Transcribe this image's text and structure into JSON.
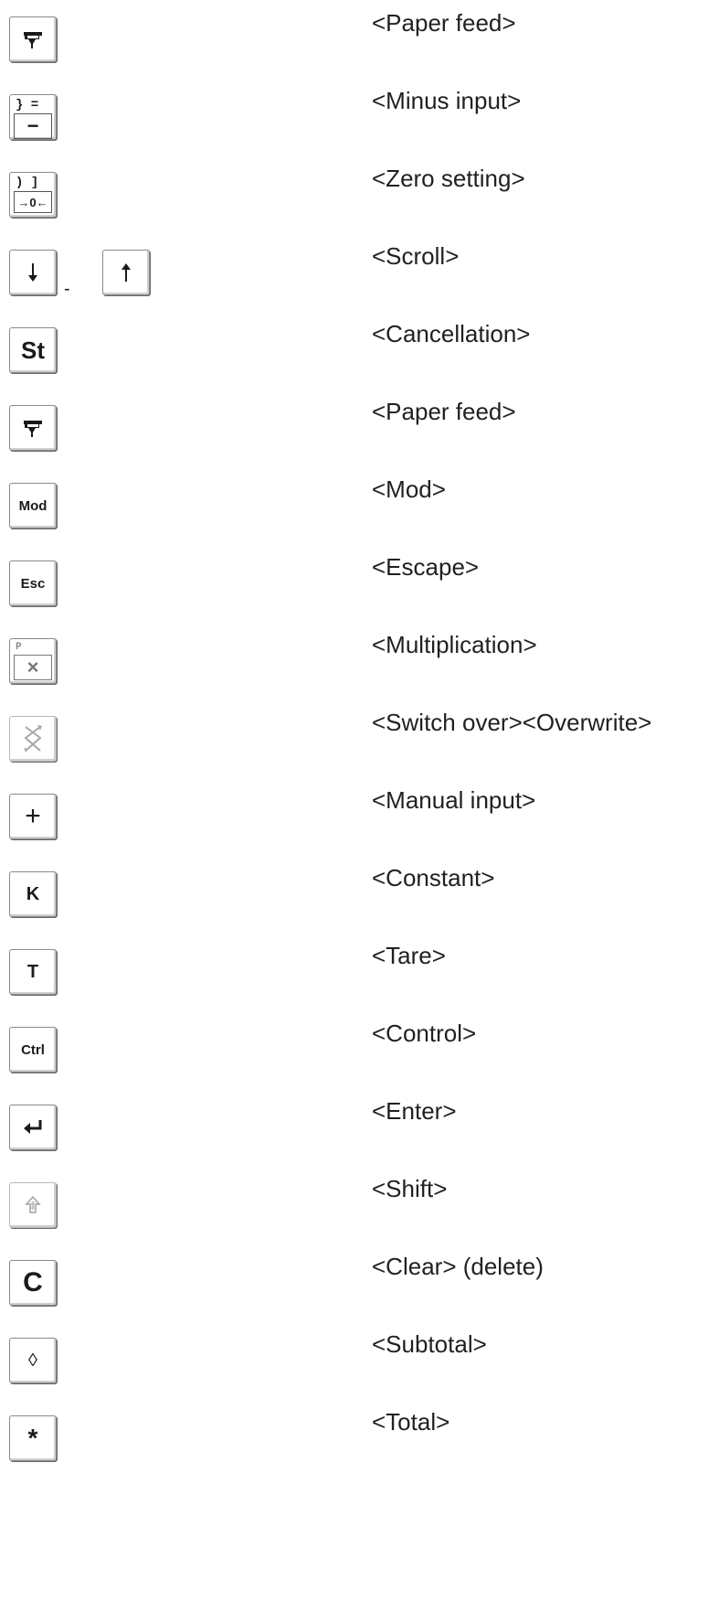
{
  "rows": [
    {
      "label": "<Paper feed>",
      "icon": "paper-feed-icon"
    },
    {
      "label": "<Minus input>",
      "icon": "minus-key-icon",
      "top": "} =",
      "bottom": "−"
    },
    {
      "label": "<Zero setting>",
      "icon": "zero-key-icon",
      "top": ") ]",
      "bottom": "→0←"
    },
    {
      "label": "<Scroll>",
      "icon": "scroll-arrows-icon",
      "sep": "-"
    },
    {
      "label": "<Cancellation>",
      "icon": "st-key-icon",
      "key": "St"
    },
    {
      "label": "<Paper feed>",
      "icon": "paper-feed-icon"
    },
    {
      "label": "<Mod>",
      "icon": "mod-key-icon",
      "key": "Mod"
    },
    {
      "label": "<Escape>",
      "icon": "esc-key-icon",
      "key": "Esc"
    },
    {
      "label": "<Multiplication>",
      "icon": "multiplication-key-icon",
      "top": "P",
      "bottom": "×"
    },
    {
      "label": "<Switch over><Overwrite>",
      "icon": "switch-over-icon"
    },
    {
      "label": "<Manual input>",
      "icon": "plus-key-icon",
      "key": "+"
    },
    {
      "label": "<Constant>",
      "icon": "k-key-icon",
      "key": "K"
    },
    {
      "label": "<Tare>",
      "icon": "t-key-icon",
      "key": "T"
    },
    {
      "label": "<Control>",
      "icon": "ctrl-key-icon",
      "key": "Ctrl"
    },
    {
      "label": "<Enter>",
      "icon": "enter-arrow-icon"
    },
    {
      "label": "<Shift>",
      "icon": "shift-arrow-icon"
    },
    {
      "label": "<Clear> (delete)",
      "icon": "c-key-icon",
      "key": "C"
    },
    {
      "label": "<Subtotal>",
      "icon": "diamond-key-icon",
      "key": "◊"
    },
    {
      "label": "<Total>",
      "icon": "asterisk-key-icon",
      "key": "*"
    }
  ]
}
